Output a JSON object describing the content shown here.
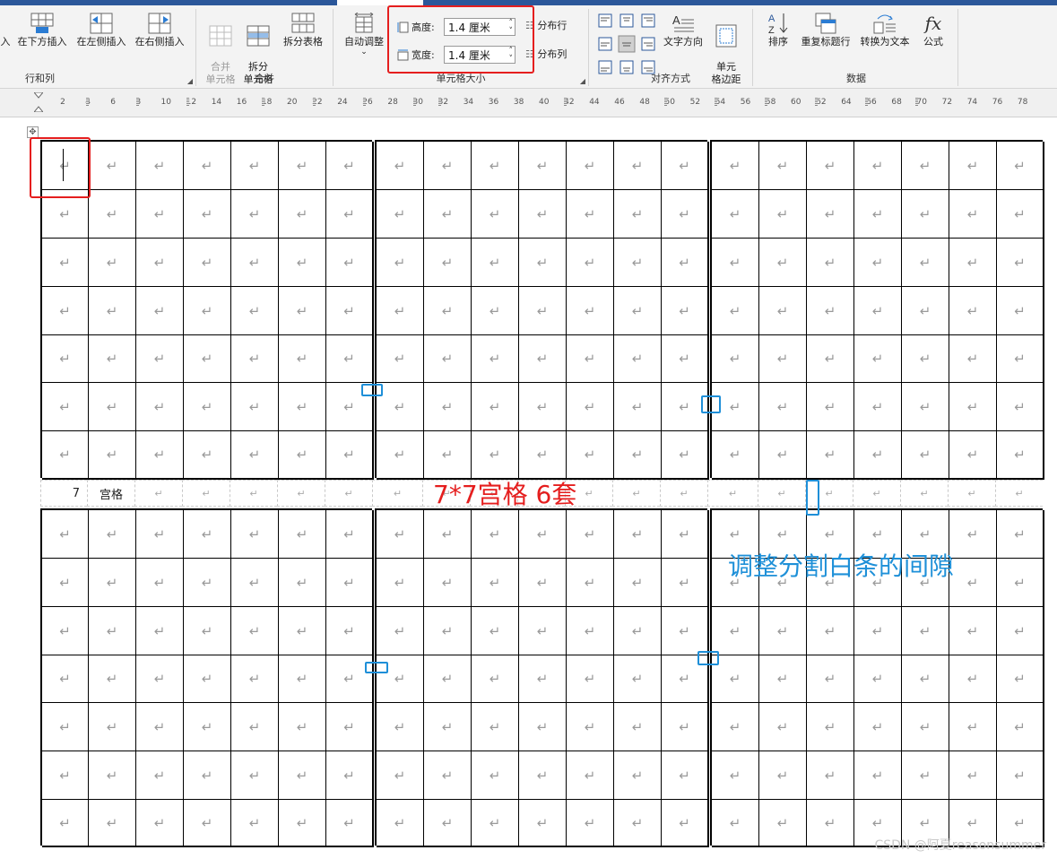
{
  "ribbon": {
    "groups": {
      "rows_cols": {
        "label": "行和列",
        "buttons": [
          "入",
          "在下方插入",
          "在左侧插入",
          "在右侧插入"
        ]
      },
      "merge": {
        "label": "合并",
        "buttons": [
          "合并\n单元格",
          "拆分\n单元格",
          "拆分表格"
        ]
      },
      "cell_size": {
        "label": "单元格大小",
        "autofit": "自动调整",
        "height_label": "高度:",
        "height_value": "1.4 厘米",
        "width_label": "宽度:",
        "width_value": "1.4 厘米",
        "dist_rows": "分布行",
        "dist_cols": "分布列"
      },
      "alignment": {
        "label": "对齐方式",
        "text_direction": "文字方向",
        "cell_margins": "单元\n格边距"
      },
      "data": {
        "label": "数据",
        "buttons": [
          "排序",
          "重复标题行",
          "转换为文本",
          "公式"
        ]
      }
    }
  },
  "ruler": {
    "ticks": [
      "2",
      "4",
      "6",
      "8",
      "10",
      "12",
      "14",
      "16",
      "18",
      "20",
      "22",
      "24",
      "26",
      "28",
      "30",
      "32",
      "34",
      "36",
      "38",
      "40",
      "42",
      "44",
      "46",
      "48",
      "50",
      "52",
      "54",
      "56",
      "58",
      "60",
      "62",
      "64",
      "66",
      "68",
      "70",
      "72",
      "74",
      "76",
      "78"
    ]
  },
  "doc": {
    "cell_mark": "↵",
    "gap_row_label_num": "7",
    "gap_row_label_text": "宫格",
    "annotation_red": "7*7宫格 6套",
    "annotation_blue": "调整分割白条的间隙",
    "watermark": "CSDN @阿夏reasonsummer"
  },
  "colors": {
    "annotation_red": "#e51e1e",
    "annotation_blue": "#1e90d8",
    "accent": "#2b579a"
  }
}
